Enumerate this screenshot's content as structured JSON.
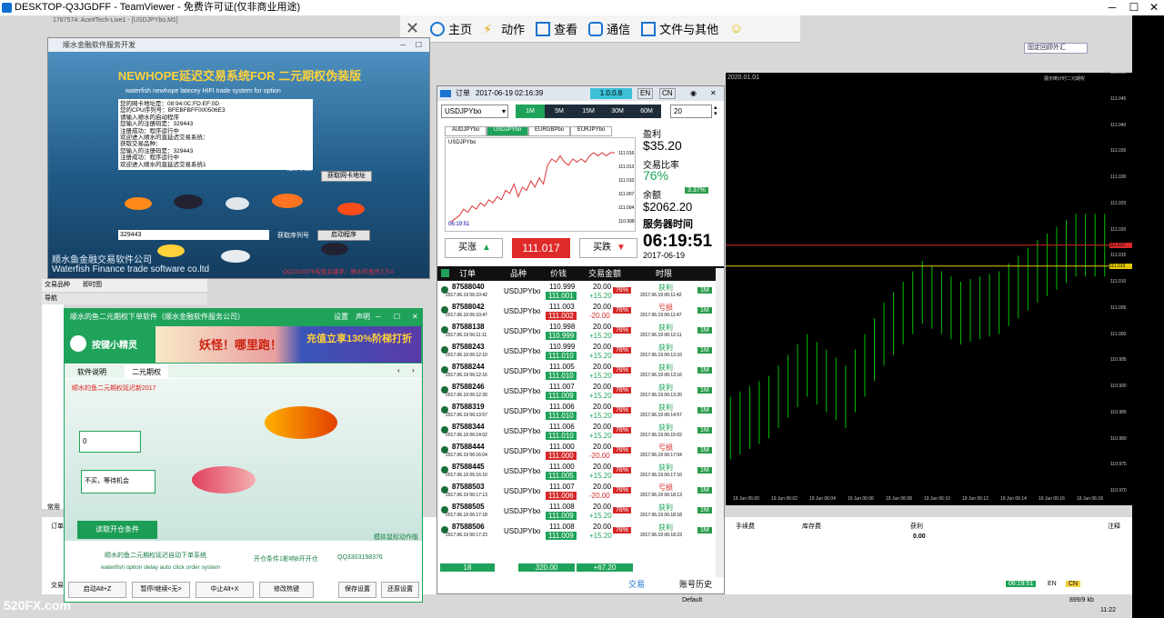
{
  "teamviewer": {
    "title": "DESKTOP-Q3JGDFF - TeamViewer - 免费许可证(仅非商业用途)",
    "toolbar": [
      {
        "label": "主页"
      },
      {
        "label": "动作"
      },
      {
        "label": "查看"
      },
      {
        "label": "通信"
      },
      {
        "label": "文件与其他"
      }
    ]
  },
  "mt4": {
    "title": "1787574: Ace#Tech-Live1 - [USDJPYbo,M1]",
    "chart_label": "USDJPYbo,M1",
    "one_click": "固定回顾外汇",
    "chart_date": "2020.01.01",
    "indicator_text": "展示倒计时二元期权",
    "price_ticks": [
      "111.050",
      "111.045",
      "111.040",
      "111.035",
      "111.030",
      "111.025",
      "111.020",
      "111.015",
      "111.010",
      "111.005",
      "111.000",
      "110.995",
      "110.990",
      "110.985",
      "110.980",
      "110.975",
      "110.970"
    ],
    "price_tag_red": "111.017",
    "price_tag_yel": "111.013",
    "time_ticks": [
      "19 Jun 06:00",
      "19 Jun 06:02",
      "19 Jun 06:04",
      "19 Jun 06:06",
      "19 Jun 06:08",
      "19 Jun 06:10",
      "19 Jun 06:12",
      "19 Jun 06:14",
      "19 Jun 06:16",
      "19 Jun 06:18"
    ],
    "terminal_cols": {
      "c1": "手续费",
      "c2": "库存费",
      "c3": "获利",
      "c4": "注释"
    },
    "terminal_profit": "0.00",
    "status_time": "06:19:51",
    "status_en": "EN",
    "status_cn": "CN",
    "status_default": "Default",
    "status_kb": "899/9 kb",
    "navigator_title": "导航",
    "nav_tabs": [
      "交易品种",
      "即时图"
    ],
    "side_tab": "常用",
    "clock": "11:22",
    "tab_orders": "订单",
    "tab_mgr": "交易"
  },
  "newhope": {
    "title": "顺水金融软件服务开发",
    "heading": "NEWHOPE延迟交易系统FOR 二元期权伪装版",
    "subheading": "waterfish newhope latecey HIFI trade system for option",
    "log_lines": [
      "您的网卡地址是：08:94:0C:FD:EF:0D",
      "您的CPU序列号：BFEBFBFF000506E3",
      "请输入顺水的启动程序",
      "您输入的注册码是：329443",
      "注册成功：程序运行中",
      "欢迎进入顺水的直延迟交易系统：",
      "获取交易品种：",
      "您输入的注册码是：329443",
      "注册成功：程序运行中",
      "欢迎进入顺水的直延迟交易系统1"
    ],
    "status_label": "程序状态",
    "get_mac_btn": "获取网卡地址",
    "serial_value": "329443",
    "get_serial_label": "获取序列号",
    "start_btn": "启动程序",
    "company_cn": "顺水鱼金融交易软件公司",
    "company_en": "Waterfish Finance trade software co.ltd",
    "qq_line": "QQ3319376淘宝关键字：顺水的鱼外汇EA"
  },
  "order": {
    "title": "订单",
    "datetime": "2017-06-19 02:16:39",
    "version": "1.0.0.8",
    "lang_en": "EN",
    "lang_cn": "CN",
    "symbol": "USDJPYbo",
    "timeframes": [
      "1M",
      "5M",
      "15M",
      "30M",
      "60M"
    ],
    "active_tf": "1M",
    "amount": "20",
    "sym_tabs": [
      "AUDJPYbo",
      "USDJPYbo",
      "EURGBPbo",
      "EURJPYbo"
    ],
    "mini_symbol": "USDJPYbo",
    "mini_time": "06:19:51",
    "mini_ticks": [
      "111.016",
      "111.013",
      "111.010",
      "111.007",
      "111.004",
      "110.998"
    ],
    "mini_chart": [
      2,
      3,
      4,
      6,
      5,
      7,
      6,
      8,
      7,
      9,
      8,
      10,
      9,
      12,
      11,
      14,
      10,
      13,
      12,
      15,
      13,
      16,
      14,
      20,
      22,
      21,
      23,
      21,
      20,
      22,
      21,
      22,
      21,
      23,
      24,
      23,
      24,
      23,
      24,
      24
    ],
    "profit_label": "盈利",
    "profit_value": "$35.20",
    "ratio_label": "交易比率",
    "ratio_value": "76%",
    "balance_label": "余额",
    "balance_pct": "3.37%",
    "balance_value": "$2062.20",
    "server_label": "服务器时间",
    "server_time": "06:19:51",
    "server_date": "2017-06-19",
    "buy_label": "买涨",
    "sell_label": "买跌",
    "price": "111.017",
    "cols": [
      "订单",
      "品种",
      "价钱",
      "交易金额",
      "时限"
    ],
    "rows": [
      {
        "id": "87588040",
        "date": "2017.06.19 06:10:42",
        "sym": "USDJPYbo",
        "p1": "110.999",
        "p2": "111.001",
        "amt": "20.00",
        "pl": "+15.20",
        "pct": "76%",
        "res": "获利",
        "t": "2017.06.19 06:11:42",
        "tf": "1M",
        "win": true
      },
      {
        "id": "87588042",
        "date": "2017.06.19 06:10:47",
        "sym": "USDJPYbo",
        "p1": "111.003",
        "p2": "111.002",
        "amt": "20.00",
        "pl": "-20.00",
        "pct": "76%",
        "res": "亏损",
        "t": "2017.06.19 06:11:47",
        "tf": "1M",
        "win": false
      },
      {
        "id": "87588138",
        "date": "2017.06.19 06:11:11",
        "sym": "USDJPYbo",
        "p1": "110.998",
        "p2": "110.999",
        "amt": "20.00",
        "pl": "+15.20",
        "pct": "76%",
        "res": "获利",
        "t": "2017.06.19 06:12:11",
        "tf": "1M",
        "win": true
      },
      {
        "id": "87588243",
        "date": "2017.06.19 06:12:10",
        "sym": "USDJPYbo",
        "p1": "110.999",
        "p2": "111.010",
        "amt": "20.00",
        "pl": "+15.20",
        "pct": "76%",
        "res": "获利",
        "t": "2017.06.19 06:13:10",
        "tf": "1M",
        "win": true
      },
      {
        "id": "87588244",
        "date": "2017.06.19 06:12:16",
        "sym": "USDJPYbo",
        "p1": "111.005",
        "p2": "111.010",
        "amt": "20.00",
        "pl": "+15.20",
        "pct": "76%",
        "res": "获利",
        "t": "2017.06.19 06:13:16",
        "tf": "1M",
        "win": true
      },
      {
        "id": "87588246",
        "date": "2017.06.19 06:12:20",
        "sym": "USDJPYbo",
        "p1": "111.007",
        "p2": "111.009",
        "amt": "20.00",
        "pl": "+15.20",
        "pct": "76%",
        "res": "获利",
        "t": "2017.06.19 06:13:20",
        "tf": "1M",
        "win": true
      },
      {
        "id": "87588319",
        "date": "2017.06.19 06:13:57",
        "sym": "USDJPYbo",
        "p1": "111.006",
        "p2": "111.010",
        "amt": "20.00",
        "pl": "+15.20",
        "pct": "76%",
        "res": "获利",
        "t": "2017.06.19 06:14:57",
        "tf": "1M",
        "win": true
      },
      {
        "id": "87588344",
        "date": "2017.06.19 06:14:02",
        "sym": "USDJPYbo",
        "p1": "111.006",
        "p2": "111.010",
        "amt": "20.00",
        "pl": "+15.20",
        "pct": "76%",
        "res": "获利",
        "t": "2017.06.19 06:15:02",
        "tf": "1M",
        "win": true
      },
      {
        "id": "87588444",
        "date": "2017.06.19 06:16:04",
        "sym": "USDJPYbo",
        "p1": "111.000",
        "p2": "111.000",
        "amt": "20.00",
        "pl": "-20.00",
        "pct": "76%",
        "res": "亏损",
        "t": "2017.06.19 06:17:04",
        "tf": "1M",
        "win": false
      },
      {
        "id": "87588445",
        "date": "2017.06.19 06:16:10",
        "sym": "USDJPYbo",
        "p1": "111.000",
        "p2": "111.005",
        "amt": "20.00",
        "pl": "+15.20",
        "pct": "76%",
        "res": "获利",
        "t": "2017.06.19 06:17:10",
        "tf": "1M",
        "win": true
      },
      {
        "id": "87588503",
        "date": "2017.06.19 06:17:13",
        "sym": "USDJPYbo",
        "p1": "111.007",
        "p2": "111.006",
        "amt": "20.00",
        "pl": "-20.00",
        "pct": "76%",
        "res": "亏损",
        "t": "2017.06.19 06:18:13",
        "tf": "1M",
        "win": false
      },
      {
        "id": "87588505",
        "date": "2017.06.19 06:17:18",
        "sym": "USDJPYbo",
        "p1": "111.008",
        "p2": "111.009",
        "amt": "20.00",
        "pl": "+15.20",
        "pct": "76%",
        "res": "获利",
        "t": "2017.06.19 06:18:18",
        "tf": "1M",
        "win": true
      },
      {
        "id": "87588506",
        "date": "2017.06.19 06:17:23",
        "sym": "USDJPYbo",
        "p1": "111.008",
        "p2": "111.009",
        "amt": "20.00",
        "pl": "+15.20",
        "pct": "76%",
        "res": "获利",
        "t": "2017.06.19 06:18:23",
        "tf": "1M",
        "win": true
      }
    ],
    "footer_count": "18",
    "footer_amt": "320.00",
    "footer_pl": "+67.20",
    "tab_trade": "交易",
    "tab_history": "账号历史"
  },
  "sprite": {
    "title": "顺水的鱼二元期权下单软件（顺水金融软件服务公司）",
    "settings": "设置",
    "statement": "声明",
    "brand": "按键小精灵",
    "banner_left": "妖怪！哪里跑！",
    "banner_right": "充值立享130%阶梯打折",
    "tabs": [
      "软件说明",
      "二元期权"
    ],
    "active_tab": "二元期权",
    "red_text": "顺水的鱼二元期权延迟新2017",
    "input1": "0",
    "input2": "不买，等待机会",
    "read_btn": "读取开仓条件",
    "sim_text": "模拟鼠标动作版",
    "line1": "顺水的鱼二元期权延迟自动下单系统",
    "line1b": "开仓条件1影响8开开仓",
    "line1c": "QQ3303198376",
    "line2": "waterfish option delay auto click order system",
    "buttons": [
      "启动Alt+Z",
      "暂停/继续<无>",
      "中止Alt+X",
      "修改热键",
      "保存设置",
      "还原设置"
    ]
  },
  "watermark": "520FX.com",
  "colors": {
    "green": "#1fa35a",
    "red": "#d62828",
    "chart_bull": "#00c000"
  },
  "chart_data": {
    "type": "bar",
    "title": "USDJPYbo,M1",
    "xlabel": "",
    "ylabel": "",
    "ylim": [
      110.97,
      111.05
    ],
    "x": [
      "19 Jun 06:00",
      "19 Jun 06:02",
      "19 Jun 06:04",
      "19 Jun 06:06",
      "19 Jun 06:08",
      "19 Jun 06:10",
      "19 Jun 06:12",
      "19 Jun 06:14",
      "19 Jun 06:16",
      "19 Jun 06:18"
    ],
    "series": [
      {
        "name": "",
        "values": [
          110.982,
          110.986,
          110.994,
          110.988,
          111.0,
          111.008,
          111.004,
          111.006,
          111.012,
          111.017
        ]
      }
    ]
  }
}
